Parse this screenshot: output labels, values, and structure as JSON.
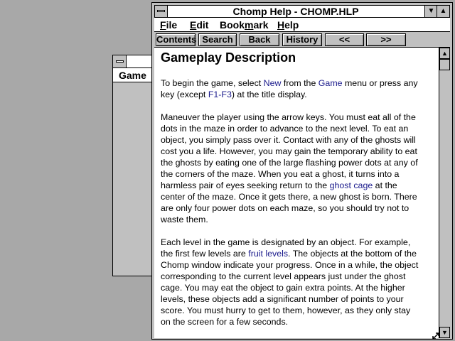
{
  "background_window": {
    "menu": [
      "Game"
    ]
  },
  "window": {
    "title": "Chomp Help - CHOMP.HLP",
    "minimize_icon": "triangle-down-icon",
    "maximize_icon": "triangle-up-icon"
  },
  "menu": {
    "file": "File",
    "edit": "Edit",
    "bookmark": "Bookmark",
    "help": "Help"
  },
  "buttons": {
    "contents": "Contents",
    "search": "Search",
    "back": "Back",
    "history": "History",
    "prev": "<<",
    "next": ">>"
  },
  "topic": {
    "heading": "Gameplay Description",
    "p1": [
      {
        "parts": [
          {
            "t": "To begin the game, select "
          },
          {
            "t": "New",
            "link": true
          },
          {
            "t": " from the "
          },
          {
            "t": "Game",
            "link": true
          },
          {
            "t": " menu or press any"
          }
        ]
      },
      {
        "parts": [
          {
            "t": "key (except "
          },
          {
            "t": "F1-F3",
            "link": true
          },
          {
            "t": ") at the title display."
          }
        ]
      }
    ],
    "p2": [
      "Maneuver the player using the arrow keys.  You must eat all of the",
      "dots in the maze in order to advance to the next level.  To eat an",
      "object, you simply pass over it.  Contact with any of the ghosts will",
      "cost you a life.  However, you may gain the temporary ability to eat",
      "the ghosts by eating one of the large flashing power dots at any of",
      "the corners of the maze.  When you eat a ghost, it turns into a",
      [
        {
          "t": "harmless pair of eyes seeking return to the "
        },
        {
          "t": "ghost cage",
          "link": true
        },
        {
          "t": " at the"
        }
      ],
      "center of the maze.  Once it gets there, a new ghost is born.  There",
      "are only four power dots on each maze, so you should try not to",
      "waste them."
    ],
    "p3": [
      "Each level in the game is designated by an object.  For example,",
      [
        {
          "t": "the first few levels are "
        },
        {
          "t": "fruit levels",
          "link": true
        },
        {
          "t": ".  The objects at the bottom of the"
        }
      ],
      "Chomp window indicate your progress.  Once in a while, the object",
      "corresponding to the current level appears just under the ghost",
      "cage.  You may eat the object to gain extra points.  At the higher",
      "levels, these objects add a significant number of points to your",
      "score.  You must hurry to get to them, however, as they only stay",
      "on the screen for a few seconds."
    ]
  },
  "colors": {
    "desktop": "#a8a8a8",
    "link": "#1a1a8c",
    "chrome": "#c0c0c0"
  }
}
